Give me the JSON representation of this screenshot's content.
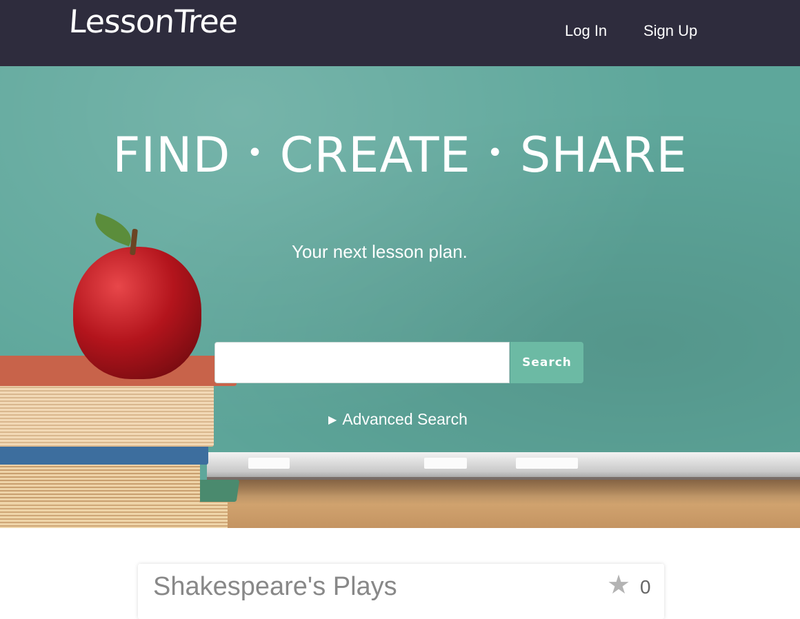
{
  "header": {
    "brand": "LessonTree",
    "login_label": "Log In",
    "signup_label": "Sign Up",
    "background_color": "#2e2c3d"
  },
  "hero": {
    "title_parts": [
      "FIND",
      "•",
      "CREATE",
      "•",
      "SHARE"
    ],
    "subtitle": "Your next lesson plan.",
    "search": {
      "value": "",
      "placeholder": "",
      "button_label": "Search",
      "button_color": "#6cbaa4"
    },
    "advanced_search_label": "Advanced Search",
    "advanced_search_icon": "triangle-right-icon"
  },
  "lesson_cards": [
    {
      "title": "Shakespeare's Plays",
      "star_icon": "star-icon",
      "star_count": "0"
    }
  ]
}
